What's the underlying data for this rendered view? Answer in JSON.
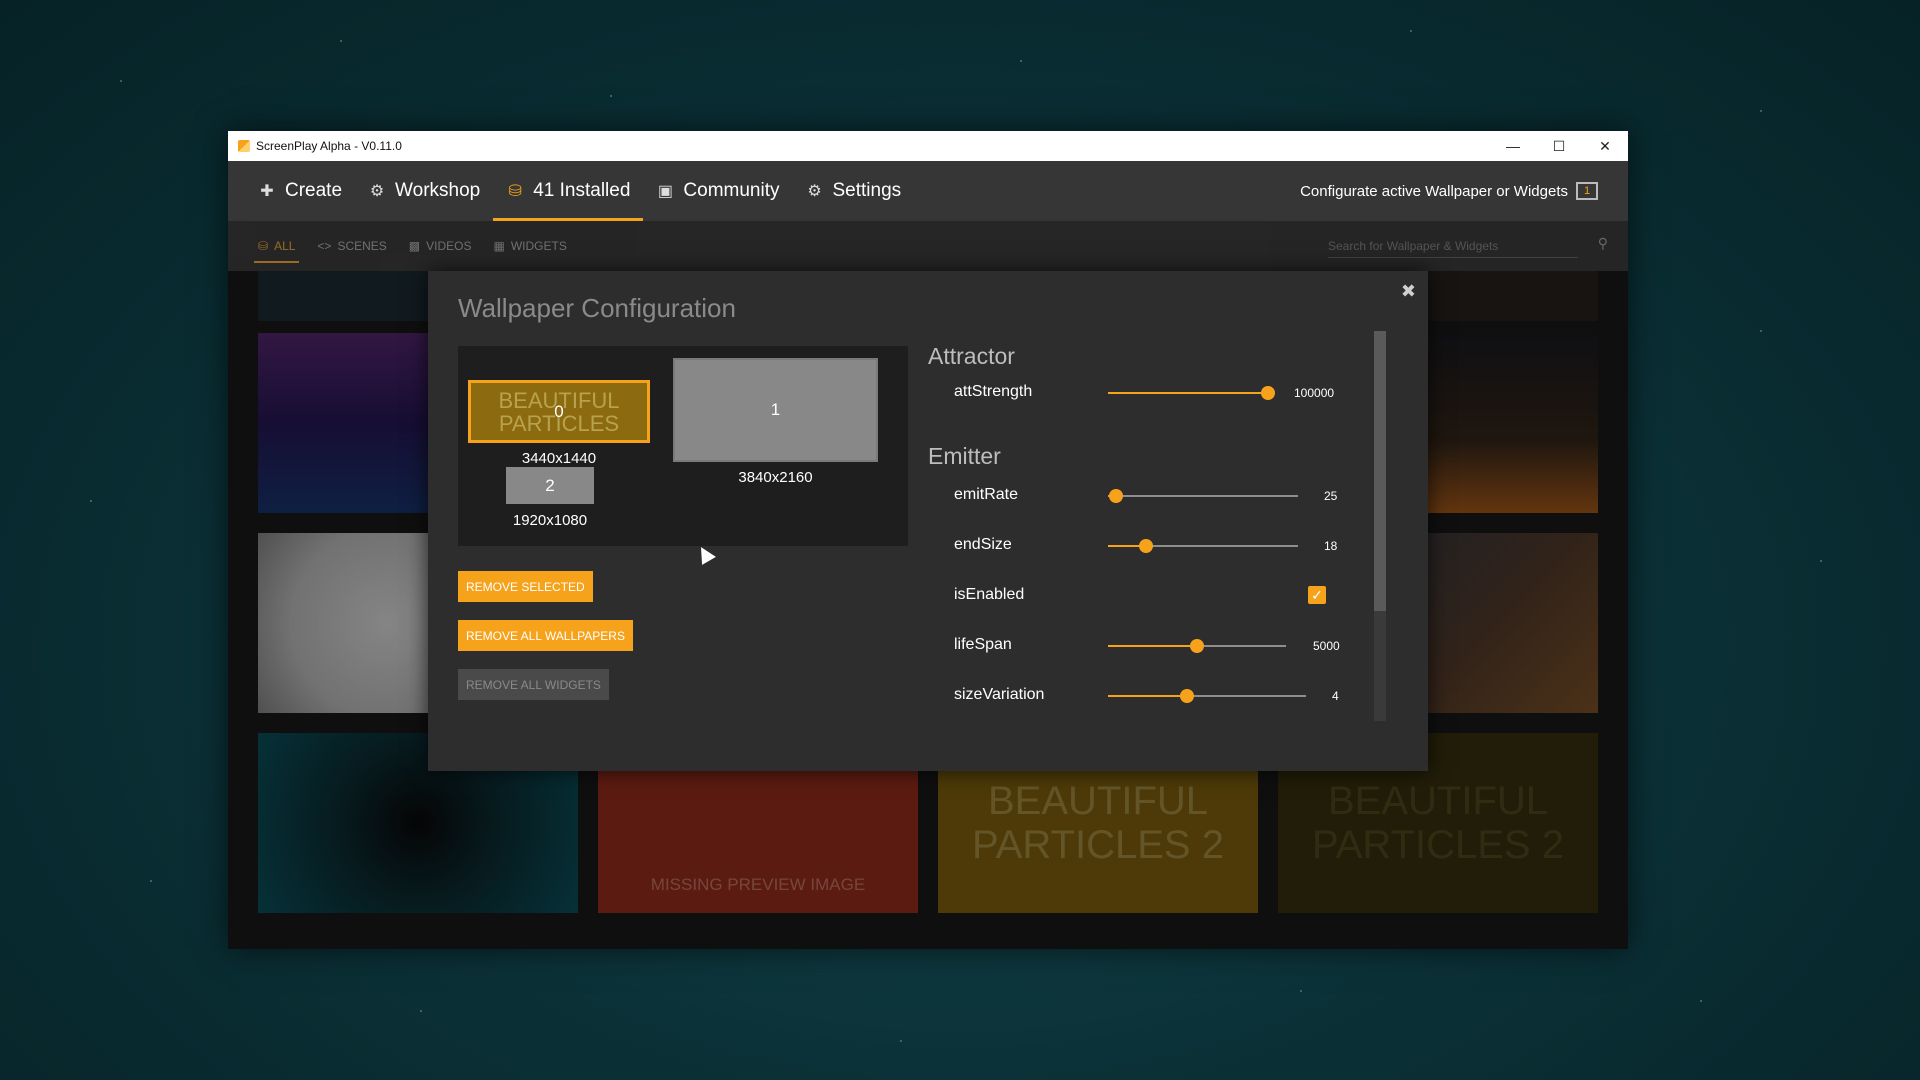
{
  "window": {
    "title": "ScreenPlay Alpha - V0.11.0"
  },
  "nav": {
    "items": [
      {
        "label": "Create",
        "icon": "plus-icon"
      },
      {
        "label": "Workshop",
        "icon": "steam-icon"
      },
      {
        "label": "41 Installed",
        "icon": "database-icon"
      },
      {
        "label": "Community",
        "icon": "chat-icon"
      },
      {
        "label": "Settings",
        "icon": "gear-icon"
      }
    ],
    "right_label": "Configurate active Wallpaper or Widgets",
    "active_count": "1"
  },
  "subnav": {
    "items": [
      "ALL",
      "SCENES",
      "VIDEOS",
      "WIDGETS"
    ],
    "search_placeholder": "Search for Wallpaper & Widgets"
  },
  "grid": {
    "missing_label": "MISSING PREVIEW IMAGE",
    "particles_text": "BEAUTIFUL PARTICLES 2"
  },
  "modal": {
    "title": "Wallpaper Configuration",
    "monitors": [
      {
        "id": "0",
        "resolution": "3440x1440",
        "preview": "BEAUTIFUL PARTICLES"
      },
      {
        "id": "1",
        "resolution": "3840x2160"
      },
      {
        "id": "2",
        "resolution": "1920x1080"
      }
    ],
    "buttons": {
      "remove_selected": "REMOVE SELECTED",
      "remove_all_wallpapers": "REMOVE ALL WALLPAPERS",
      "remove_all_widgets": "REMOVE ALL WIDGETS"
    },
    "sections": {
      "attractor": {
        "title": "Attractor",
        "props": [
          {
            "label": "attStrength",
            "value": "100000",
            "fraction": 1.0
          }
        ]
      },
      "emitter": {
        "title": "Emitter",
        "props": [
          {
            "label": "emitRate",
            "value": "25",
            "fraction": 0.04
          },
          {
            "label": "endSize",
            "value": "18",
            "fraction": 0.2
          },
          {
            "label": "isEnabled",
            "checked": true
          },
          {
            "label": "lifeSpan",
            "value": "5000",
            "fraction": 0.5
          },
          {
            "label": "sizeVariation",
            "value": "4",
            "fraction": 0.4
          }
        ]
      }
    }
  },
  "colors": {
    "accent": "#f7a21b",
    "panel": "#2d2d2d",
    "navbar": "#363636"
  }
}
